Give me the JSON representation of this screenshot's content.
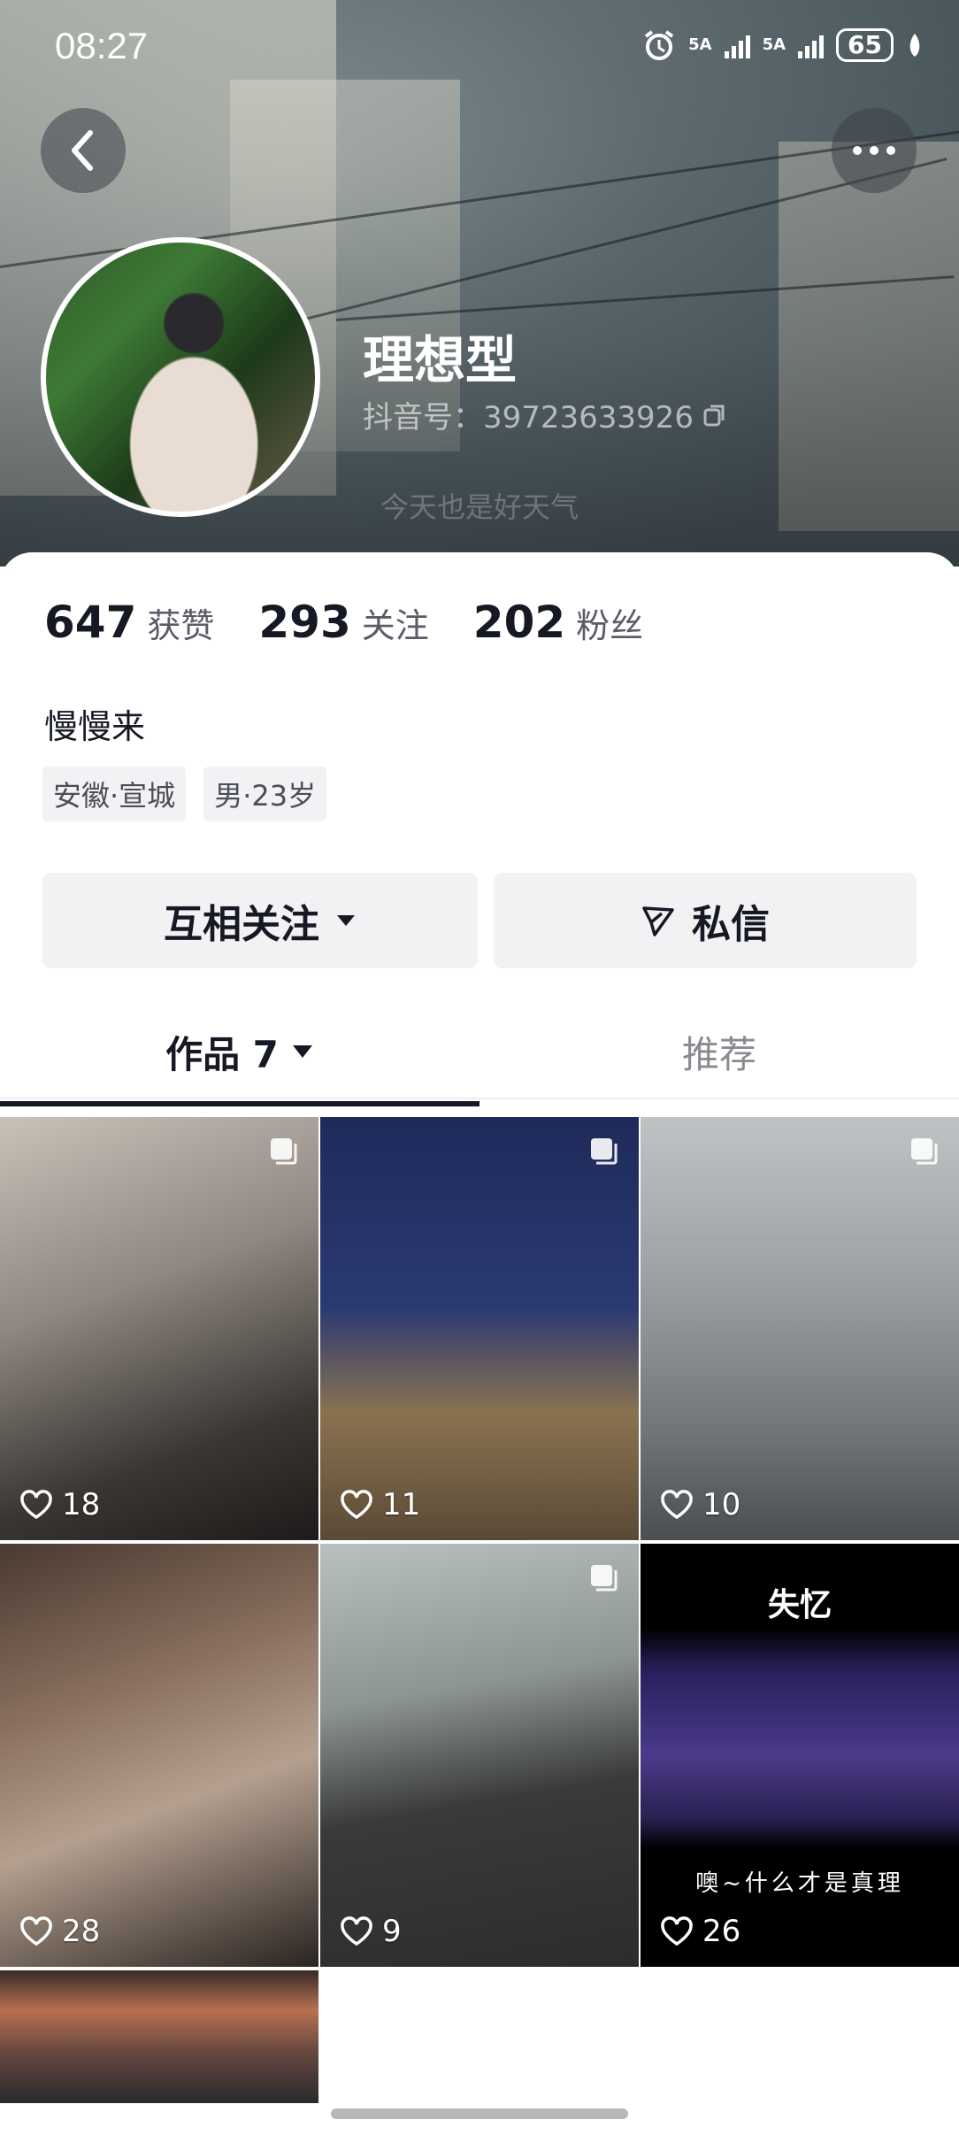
{
  "status_bar": {
    "time": "08:27",
    "net1": "5A",
    "net2": "5A",
    "battery": "65"
  },
  "profile": {
    "name": "理想型",
    "douyin_id": "抖音号：39723633926",
    "background_text": "今天也是好天气",
    "bio": "慢慢来",
    "tags": [
      "安徽·宣城",
      "男·23岁"
    ]
  },
  "stats": [
    {
      "value": "647",
      "label": "获赞"
    },
    {
      "value": "293",
      "label": "关注"
    },
    {
      "value": "202",
      "label": "粉丝"
    }
  ],
  "buttons": {
    "follow": "互相关注",
    "message": "私信"
  },
  "tabs": {
    "works": "作品 7",
    "recommend": "推荐"
  },
  "videos": [
    {
      "likes": "18",
      "multi": true
    },
    {
      "likes": "11",
      "multi": true
    },
    {
      "likes": "10",
      "multi": true
    },
    {
      "likes": "28",
      "multi": false
    },
    {
      "likes": "9",
      "multi": true
    },
    {
      "likes": "26",
      "multi": false,
      "title": "失忆",
      "caption": "噢~什么才是真理"
    },
    {
      "likes": "",
      "multi": false
    }
  ]
}
